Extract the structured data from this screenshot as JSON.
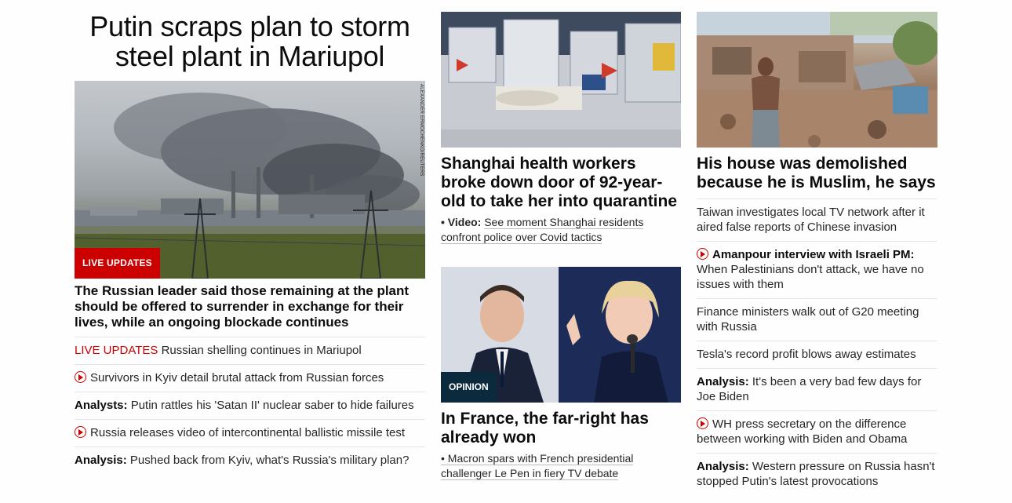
{
  "lead": {
    "title": "Putin scraps plan to storm steel plant in Mariupol",
    "photo_credit": "ALEXANDER ERMOCHENKO/REUTERS",
    "badge": "LIVE UPDATES",
    "summary": "The Russian leader said those remaining at the plant should be offered to surrender in exchange for their lives, while an ongoing blockade continues",
    "items": [
      {
        "tag": "LIVE UPDATES",
        "text": "Russian shelling continues in Mariupol"
      },
      {
        "text": "Survivors in Kyiv detail brutal attack from Russian forces"
      },
      {
        "prefix": "Analysts:",
        "text": "Putin rattles his 'Satan II' nuclear saber to hide failures"
      },
      {
        "text": "Russia releases video of intercontinental ballistic missile test"
      },
      {
        "prefix": "Analysis:",
        "text": "Pushed back from Kyiv, what's Russia's military plan?"
      }
    ]
  },
  "shanghai": {
    "title": "Shanghai health workers broke down door of 92-year-old to take her into quarantine",
    "sub_prefix": "• Video:",
    "sub_text": "See moment Shanghai residents confront police over Covid tactics"
  },
  "france": {
    "badge": "OPINION",
    "title": "In France, the far-right has already won",
    "sub_text": "• Macron spars with French presidential challenger Le Pen in fiery TV debate"
  },
  "right": {
    "title": "His house was demolished because he is Muslim, he says",
    "items": [
      {
        "text": "Taiwan investigates local TV network after it aired false reports of Chinese invasion"
      },
      {
        "prefix": "Amanpour interview with Israeli PM:",
        "text": "When Palestinians don't attack, we have no issues with them"
      },
      {
        "text": "Finance ministers walk out of G20 meeting with Russia"
      },
      {
        "text": "Tesla's record profit blows away estimates"
      },
      {
        "prefix": "Analysis:",
        "text": "It's been a very bad few days for Joe Biden"
      },
      {
        "text": "WH press secretary on the difference between working with Biden and Obama"
      },
      {
        "prefix": "Analysis:",
        "text": "Western pressure on Russia hasn't stopped Putin's latest provocations"
      }
    ]
  },
  "colors": {
    "accent_red": "#cc0000",
    "opinion_badge": "#0c2a3d"
  },
  "icons": {
    "video": "play-circle-icon"
  }
}
